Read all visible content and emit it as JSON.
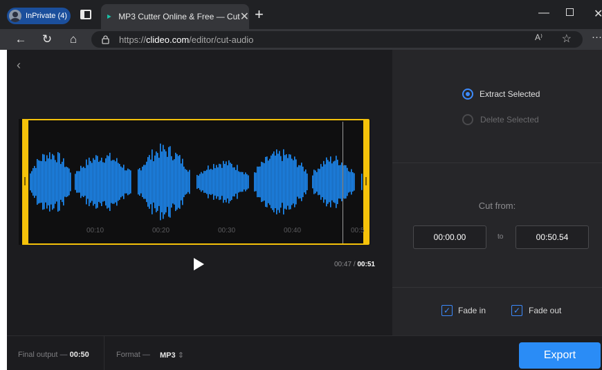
{
  "browser": {
    "inprivate_label": "InPrivate (4)",
    "tab_title": "MP3 Cutter Online & Free — Cut",
    "url_prefix": "https://",
    "url_domain": "clideo.com",
    "url_path": "/editor/cut-audio",
    "read_aloud": "A⁾",
    "colors": {
      "tab_bg": "#35363a",
      "frame_bg": "#202124",
      "inprivate": "#1b4f9c"
    }
  },
  "editor": {
    "timeline_ticks": [
      "00:10",
      "00:20",
      "00:30",
      "00:40",
      "00:5"
    ],
    "current_time": "00:47",
    "time_separator": "/",
    "total_time": "00:51",
    "colors": {
      "waveform": "#1e90ff",
      "selection": "#f5c20a",
      "background": "#1c1c1f"
    }
  },
  "panel": {
    "extract_label": "Extract Selected",
    "delete_label": "Delete Selected",
    "selected_mode": "extract",
    "cut_from_label": "Cut from:",
    "start_value": "00:00.00",
    "to_label": "to",
    "end_value": "00:50.54",
    "fade_in_label": "Fade in",
    "fade_in_checked": true,
    "fade_out_label": "Fade out",
    "fade_out_checked": true
  },
  "footer": {
    "final_output_label": "Final output —",
    "final_output_value": "00:50",
    "format_label": "Format —",
    "format_value": "MP3",
    "export_label": "Export",
    "accent_color": "#2a8cf6"
  }
}
